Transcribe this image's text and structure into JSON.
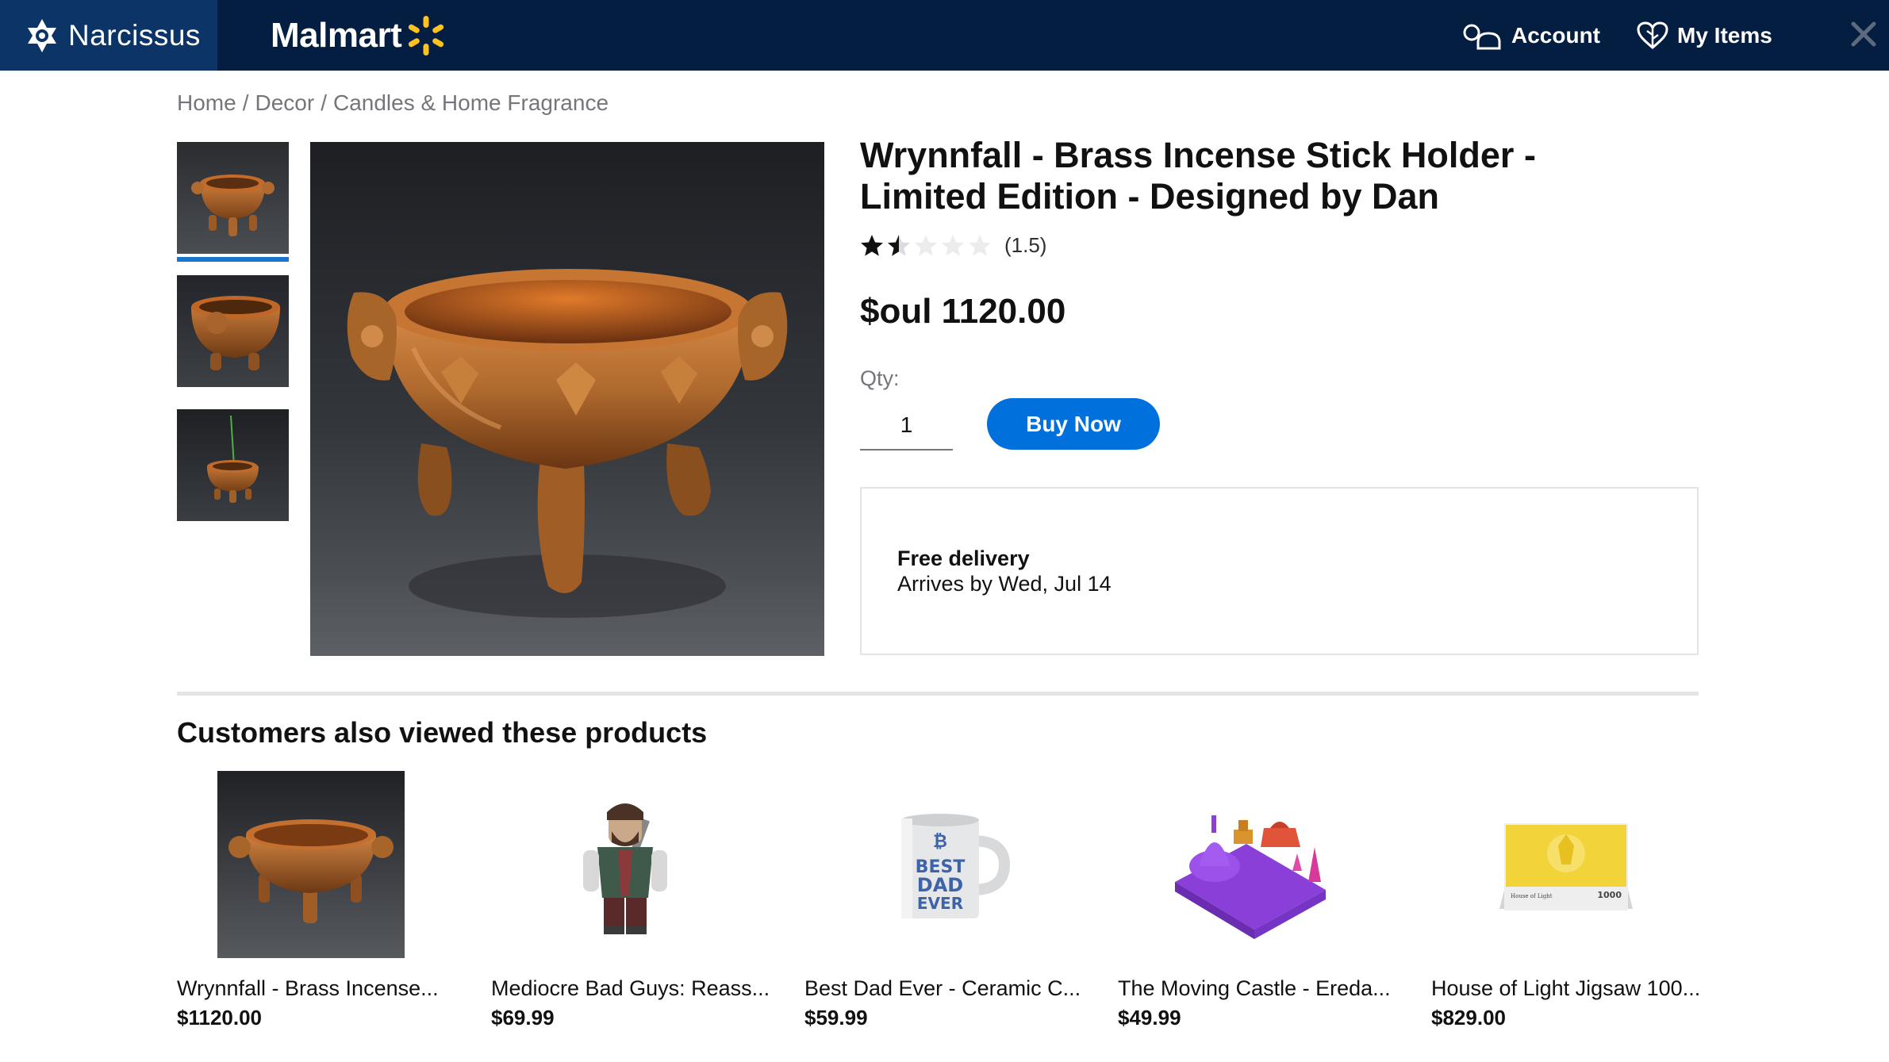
{
  "header": {
    "brand_name": "Narcissus",
    "store_name": "Malmart",
    "account_label": "Account",
    "my_items_label": "My Items",
    "colors": {
      "bar": "#041e42",
      "brand_bg": "#0c3466",
      "spark": "#ffc220"
    }
  },
  "breadcrumb": {
    "items": [
      "Home",
      "Decor",
      "Candles & Home Fragrance"
    ],
    "separator": "/"
  },
  "product": {
    "title": "Wrynnfall - Brass Incense Stick Holder - Limited Edition - Designed by Dan",
    "rating_value": 1.5,
    "rating_max": 5,
    "rating_text": "(1.5)",
    "price": "$oul 1120.00",
    "qty_label": "Qty:",
    "qty_value": "1",
    "buy_label": "Buy Now",
    "delivery_title": "Free delivery",
    "delivery_subtitle": "Arrives by Wed, Jul 14",
    "thumbnails": [
      "bowl-front-thumbnail",
      "bowl-side-thumbnail",
      "bowl-incense-thumbnail"
    ],
    "selected_thumbnail": 0,
    "accent_color": "#0071dc"
  },
  "recommendations": {
    "heading": "Customers also viewed these products",
    "items": [
      {
        "name": "Wrynnfall - Brass Incense...",
        "price": "$1120.00",
        "image": "brass-bowl-image"
      },
      {
        "name": "Mediocre Bad Guys: Reass...",
        "price": "$69.99",
        "image": "minifigure-image"
      },
      {
        "name": "Best Dad Ever - Ceramic C...",
        "price": "$59.99",
        "image": "mug-image"
      },
      {
        "name": "The Moving Castle - Ereda...",
        "price": "$49.99",
        "image": "castle-tray-image"
      },
      {
        "name": "House of Light Jigsaw 100...",
        "price": "$829.00",
        "image": "puzzle-box-image"
      }
    ]
  },
  "mug_text": [
    "BEST",
    "DAD",
    "EVER"
  ],
  "puzzle_box_text": {
    "left": "House of Light",
    "right": "1000"
  }
}
